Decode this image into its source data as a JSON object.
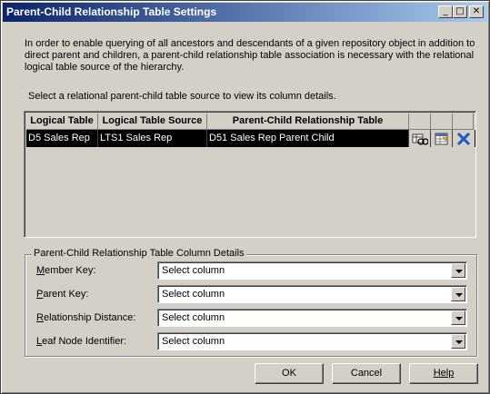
{
  "window": {
    "title": "Parent-Child Relationship Table Settings",
    "minimize_glyph": "_",
    "maximize_glyph": "□",
    "close_glyph": "✕"
  },
  "intro_text": "In order to enable querying of all ancestors and descendants of a given repository object in addition to direct parent and children, a parent-child relationship table association is necessary with the relational logical table source of the hierarchy.",
  "select_hint": "Select a relational parent-child table source to view its column details.",
  "grid": {
    "headers": [
      "Logical Table",
      "Logical Table Source",
      "Parent-Child Relationship Table"
    ],
    "rows": [
      {
        "logical_table": "D5 Sales Rep",
        "logical_table_source": "LTS1 Sales Rep",
        "relationship_table": "D51 Sales Rep Parent Child",
        "icons": [
          "select-table-icon",
          "edit-table-icon",
          "delete-icon"
        ]
      }
    ],
    "colors": {
      "selected_row_bg": "#000000",
      "selected_row_fg": "#ffffff"
    }
  },
  "details": {
    "legend": "Parent-Child Relationship Table Column Details",
    "fields": [
      {
        "label_mnemonic": "M",
        "label_rest": "ember Key:",
        "value": "Select column"
      },
      {
        "label_mnemonic": "P",
        "label_rest": "arent Key:",
        "value": "Select column"
      },
      {
        "label_mnemonic": "R",
        "label_rest": "elationship Distance:",
        "value": "Select column"
      },
      {
        "label_mnemonic": "L",
        "label_rest": "eaf Node Identifier:",
        "value": "Select column"
      }
    ]
  },
  "buttons": {
    "ok": "OK",
    "cancel": "Cancel",
    "help": "Help"
  },
  "colors": {
    "titlebar_start": "#0a246a",
    "titlebar_end": "#a6caf0",
    "dialog_bg": "#d4d0c8"
  }
}
